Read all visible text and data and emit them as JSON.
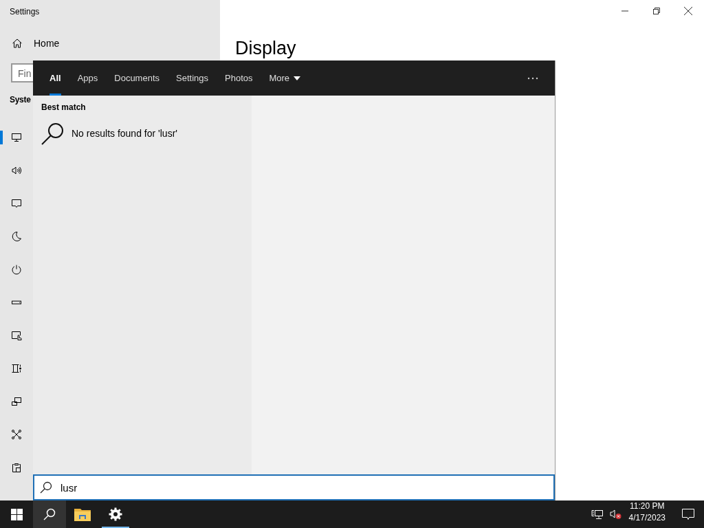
{
  "window": {
    "title": "Settings"
  },
  "sidebar": {
    "home": "Home",
    "find_field": {
      "placeholder": "Fin"
    },
    "section": "Syste",
    "nav_items": [
      {
        "kind": "display",
        "selected": true
      },
      {
        "kind": "sound",
        "selected": false
      },
      {
        "kind": "notifications",
        "selected": false
      },
      {
        "kind": "focus",
        "selected": false
      },
      {
        "kind": "power",
        "selected": false
      },
      {
        "kind": "storage",
        "selected": false
      },
      {
        "kind": "tablet",
        "selected": false
      },
      {
        "kind": "multitasking",
        "selected": false
      },
      {
        "kind": "projecting",
        "selected": false
      },
      {
        "kind": "shared",
        "selected": false
      },
      {
        "kind": "clipboard",
        "selected": false
      }
    ]
  },
  "page": {
    "title": "Display"
  },
  "search": {
    "tabs": [
      {
        "label": "All",
        "selected": true
      },
      {
        "label": "Apps",
        "selected": false
      },
      {
        "label": "Documents",
        "selected": false
      },
      {
        "label": "Settings",
        "selected": false
      },
      {
        "label": "Photos",
        "selected": false
      },
      {
        "label": "More",
        "selected": false,
        "kind": "dropdown"
      }
    ],
    "section": "Best match",
    "result": "No results found for 'lusr'",
    "query": "lusr"
  },
  "taskbar": {
    "buttons": [
      {
        "kind": "start",
        "active": false,
        "running": false
      },
      {
        "kind": "search",
        "active": true,
        "running": false
      },
      {
        "kind": "explorer",
        "active": false,
        "running": false
      },
      {
        "kind": "settings",
        "active": false,
        "running": true
      }
    ],
    "time": "11:20 PM",
    "date": "4/17/2023"
  }
}
